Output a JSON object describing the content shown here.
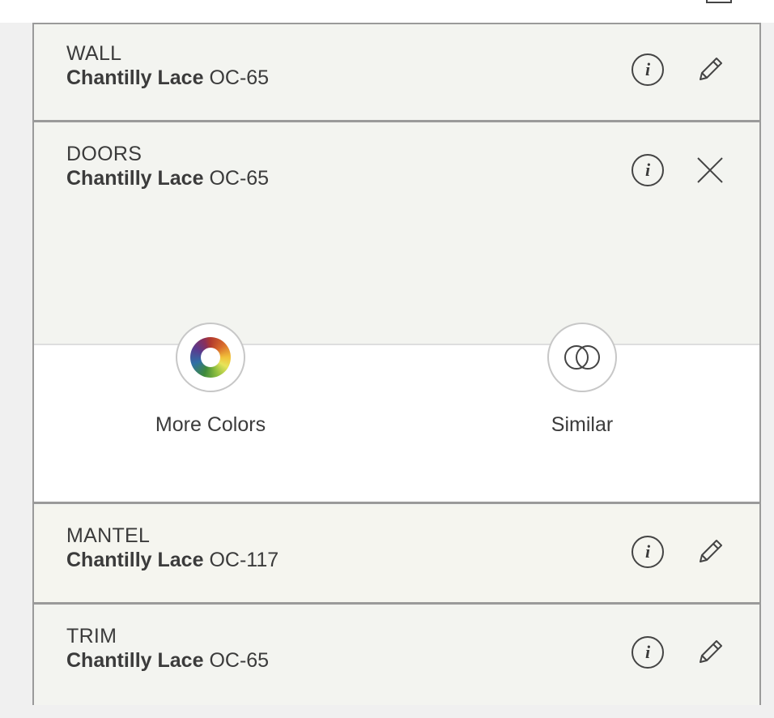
{
  "rows": [
    {
      "room": "WALL",
      "color_name": "Chantilly Lace",
      "color_code": "OC-65",
      "action": "edit"
    },
    {
      "room": "DOORS",
      "color_name": "Chantilly Lace",
      "color_code": "OC-65",
      "action": "close"
    },
    {
      "room": "MANTEL",
      "color_name": "Chantilly Lace",
      "color_code": "OC-117",
      "action": "edit"
    },
    {
      "room": "TRIM",
      "color_name": "Chantilly Lace",
      "color_code": "OC-65",
      "action": "edit"
    }
  ],
  "expanded_actions": {
    "more_colors_label": "More Colors",
    "similar_label": "Similar"
  },
  "icons": {
    "info": "info-icon",
    "edit": "pencil-icon",
    "close": "close-icon",
    "more_colors": "color-wheel-icon",
    "similar": "overlapping-circles-icon"
  },
  "info_glyph": "i",
  "colors": {
    "swatch_oc65": "#f3f4f0",
    "swatch_oc117": "#f5f5ef",
    "divider": "#9a9a9a"
  }
}
